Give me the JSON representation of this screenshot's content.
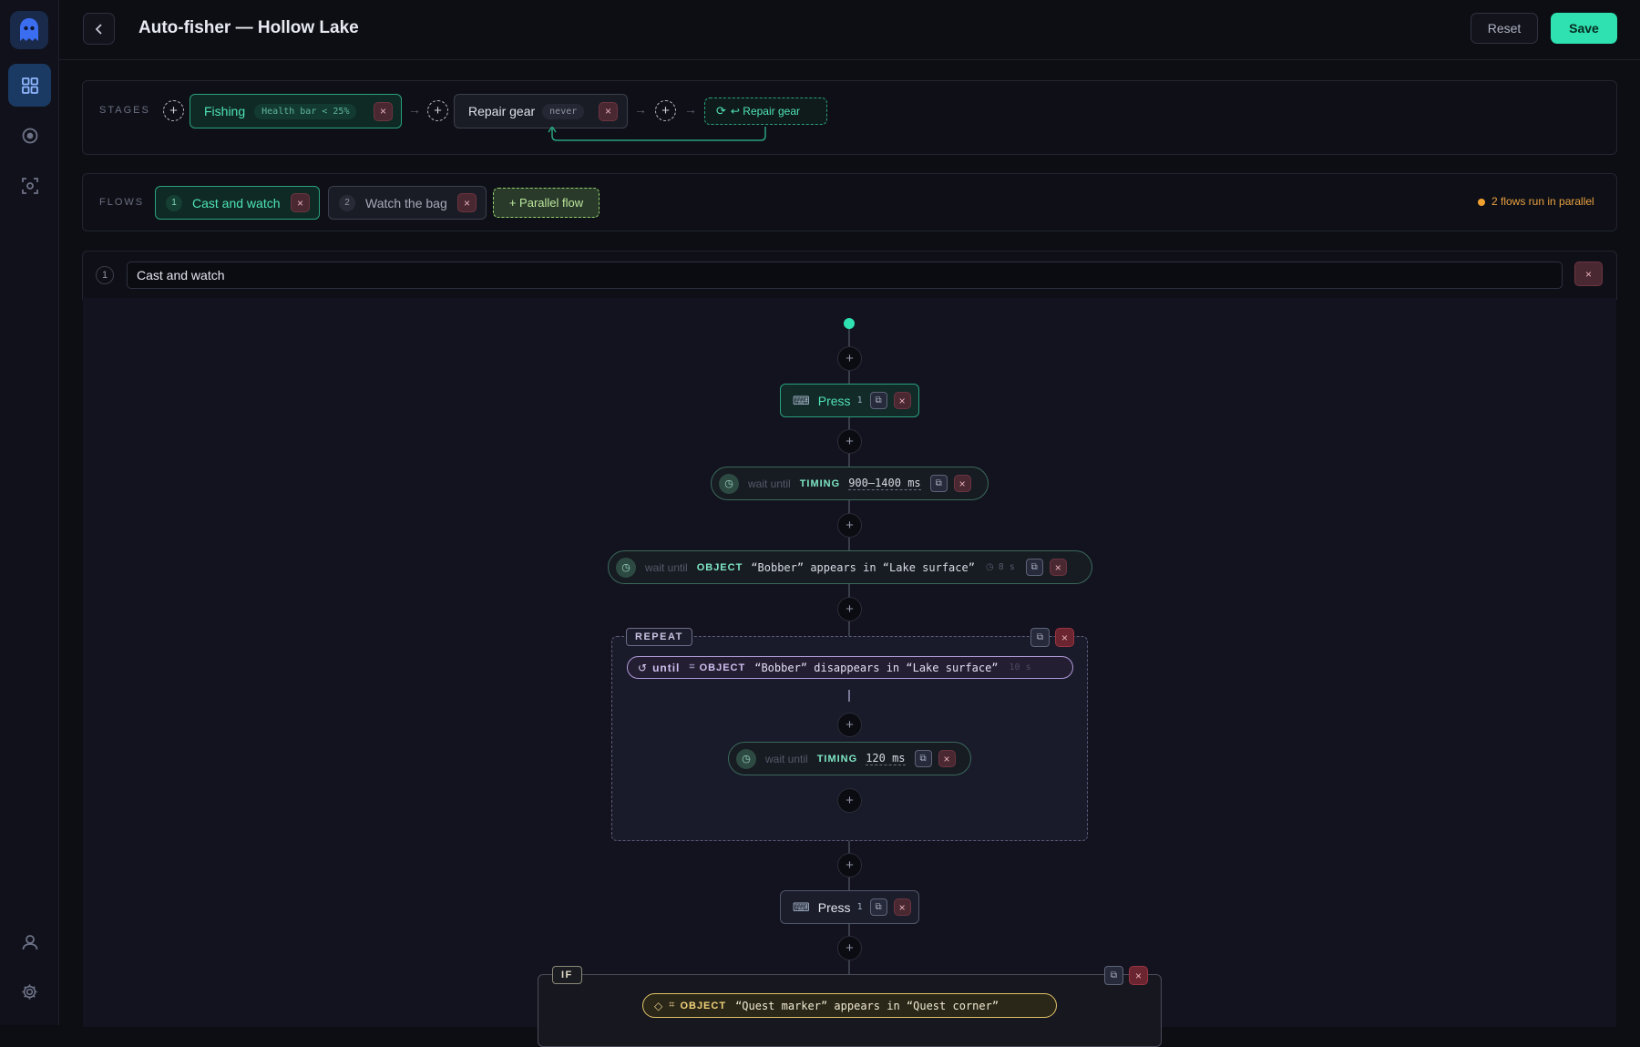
{
  "header": {
    "title": "Auto-fisher — Hollow Lake",
    "reset_label": "Reset",
    "save_label": "Save"
  },
  "stages": {
    "label": "STAGES",
    "items": [
      {
        "name": "Fishing",
        "condition": "Health bar < 25%"
      },
      {
        "name": "Repair gear",
        "condition": "never"
      }
    ],
    "loop_label": "↩ Repair gear"
  },
  "flows": {
    "label": "FLOWS",
    "items": [
      {
        "index": "1",
        "name": "Cast and watch"
      },
      {
        "index": "2",
        "name": "Watch the bag"
      }
    ],
    "add_label": "+ Parallel flow",
    "status": "2 flows run in parallel"
  },
  "flow_editor": {
    "index": "1",
    "name_value": "Cast and watch"
  },
  "nodes": {
    "press1": {
      "label": "Press",
      "count": "1"
    },
    "wait1": {
      "prefix": "wait until",
      "kind": "TIMING",
      "value": "900–1400 ms"
    },
    "wait2": {
      "prefix": "wait until",
      "kind": "OBJECT",
      "value": "“Bobber” appears in “Lake surface”",
      "timeout": "8 s"
    },
    "repeat": {
      "label": "REPEAT",
      "until_kw": "until",
      "kind": "OBJECT",
      "value": "“Bobber” disappears in “Lake surface”",
      "timeout": "10 s",
      "inner": {
        "prefix": "wait until",
        "kind": "TIMING",
        "value": "120 ms"
      }
    },
    "press2": {
      "label": "Press",
      "count": "1"
    },
    "if": {
      "label": "IF",
      "kind": "OBJECT",
      "value": "“Quest marker” appears in “Quest corner”"
    }
  }
}
